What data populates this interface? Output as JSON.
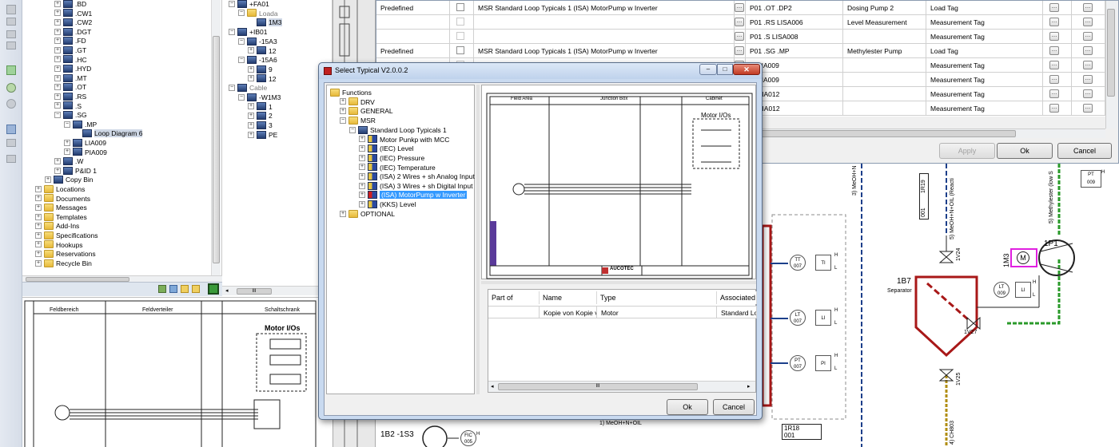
{
  "left_tree": {
    "items": [
      {
        "text": ".BD",
        "level": 3
      },
      {
        "text": ".CW1",
        "level": 3
      },
      {
        "text": ".CW2",
        "level": 3
      },
      {
        "text": ".DGT",
        "level": 3
      },
      {
        "text": ".FD",
        "level": 3
      },
      {
        "text": ".GT",
        "level": 3
      },
      {
        "text": ".HC",
        "level": 3
      },
      {
        "text": ".HYD",
        "level": 3
      },
      {
        "text": ".MT",
        "level": 3
      },
      {
        "text": ".OT",
        "level": 3
      },
      {
        "text": ".RS",
        "level": 3
      },
      {
        "text": ".S",
        "level": 3
      },
      {
        "text": ".SG",
        "level": 3
      },
      {
        "text": ".MP",
        "level": 4
      },
      {
        "text": "Loop Diagram 6",
        "level": 5
      },
      {
        "text": "LIA009",
        "level": 4
      },
      {
        "text": "PIA009",
        "level": 4
      },
      {
        "text": ".W",
        "level": 3
      },
      {
        "text": "P&ID 1",
        "level": 3
      },
      {
        "text": "Copy Bin",
        "level": 2
      },
      {
        "text": "Locations",
        "level": 1
      },
      {
        "text": "Documents",
        "level": 1
      },
      {
        "text": "Messages",
        "level": 1
      },
      {
        "text": "Templates",
        "level": 1
      },
      {
        "text": "Add-Ins",
        "level": 1
      },
      {
        "text": "Specifications",
        "level": 1
      },
      {
        "text": "Hookups",
        "level": 1
      },
      {
        "text": "Reservations",
        "level": 1
      },
      {
        "text": "Recycle Bin",
        "level": 1
      }
    ]
  },
  "mid_tree": {
    "items": [
      {
        "text": "+FA01",
        "level": 1
      },
      {
        "text": "Loada",
        "level": 2
      },
      {
        "text": "1M3",
        "level": 3
      },
      {
        "text": "+IB01",
        "level": 1
      },
      {
        "text": "-15A3",
        "level": 2
      },
      {
        "text": "12",
        "level": 3
      },
      {
        "text": "-15A6",
        "level": 2
      },
      {
        "text": "9",
        "level": 3
      },
      {
        "text": "12",
        "level": 3
      },
      {
        "text": "Cable",
        "level": 1
      },
      {
        "text": "-W1M3",
        "level": 2
      },
      {
        "text": "1",
        "level": 3
      },
      {
        "text": "2",
        "level": 3
      },
      {
        "text": "3",
        "level": 3
      },
      {
        "text": "PE",
        "level": 3
      }
    ]
  },
  "left_drawing": {
    "col1": "Feldbereich",
    "col2": "Feldverteiler",
    "col3": "Schaltschrank",
    "box_title": "Motor I/Os"
  },
  "grid": {
    "rows": [
      {
        "c1": "Predefined",
        "c2": "MSR Standard Loop Typicals 1 (ISA) MotorPump w Inverter",
        "c3": "P01 .OT .DP2",
        "c4": "Dosing Pump 2",
        "c5": "Load Tag"
      },
      {
        "c1": "",
        "c2": "",
        "c3": "P01 .RS LISA006",
        "c4": "Level Measurement",
        "c5": "Measurement Tag"
      },
      {
        "c1": "",
        "c2": "",
        "c3": "P01 .S LISA008",
        "c4": "",
        "c5": "Measurement Tag"
      },
      {
        "c1": "Predefined",
        "c2": "MSR Standard Loop Typicals 1 (ISA) MotorPump w Inverter",
        "c3": "P01 .SG .MP",
        "c4": "Methylester Pump",
        "c5": "Load Tag"
      },
      {
        "c1": "",
        "c2": "",
        "c3": "G PIA009",
        "c4": "",
        "c5": "Measurement Tag"
      },
      {
        "c1": "",
        "c2": "",
        "c3": "G PIA009",
        "c4": "",
        "c5": "Measurement Tag"
      },
      {
        "c1": "",
        "c2": "",
        "c3": "W LIA012",
        "c4": "",
        "c5": "Measurement Tag"
      },
      {
        "c1": "",
        "c2": "",
        "c3": "W TIA012",
        "c4": "",
        "c5": "Measurement Tag"
      }
    ],
    "apply_label": "Apply",
    "ok_label": "Ok",
    "cancel_label": "Cancel"
  },
  "pid": {
    "pt_label": "PT",
    "pt_num": "009",
    "motor_tag": "1M3",
    "motor_letter": "M",
    "pump_tag": "1P1",
    "separator_tag": "1B7",
    "separator_label": "Separator",
    "lt1": "LT",
    "lt1_num": "009",
    "li": "LI",
    "valve1": "1V24",
    "valve2": "1V27",
    "valve3": "1V25",
    "tt": "TT",
    "tt_num": "007",
    "ti": "TI",
    "lt2": "LT",
    "lt2_num": "007",
    "li2": "LI",
    "pt2": "PT",
    "pt2_num": "007",
    "pi2": "PI",
    "h": "H",
    "l": "L",
    "tag_1r19": "1R19",
    "num_001a": "001",
    "tag_1r18": "1R18",
    "num_001b": "001",
    "bottom_tag": "1B2 -1S3",
    "fic": "FIC",
    "fic_num": "005",
    "line_meoh": "3) MeOH+N",
    "line_meoh2": "5) MeOH+N+OIL (Reacti",
    "line_methylester": "5) Methylester (low S",
    "line_bottom": "1) MeOH+N+OIL",
    "line_ch": "4) CH803"
  },
  "dialog": {
    "title": "Select Typical V2.0.0.2",
    "tree": [
      {
        "text": "Functions",
        "level": 0,
        "exp": ""
      },
      {
        "text": "DRV",
        "level": 1,
        "exp": "+"
      },
      {
        "text": "GENERAL",
        "level": 1,
        "exp": "+"
      },
      {
        "text": "MSR",
        "level": 1,
        "exp": "-"
      },
      {
        "text": "Standard Loop Typicals 1",
        "level": 2,
        "exp": "-"
      },
      {
        "text": "Motor Punkp with MCC",
        "level": 3,
        "exp": "+"
      },
      {
        "text": "(IEC) Level",
        "level": 3,
        "exp": "+"
      },
      {
        "text": "(IEC) Pressure",
        "level": 3,
        "exp": "+"
      },
      {
        "text": "(IEC) Temperature",
        "level": 3,
        "exp": "+"
      },
      {
        "text": "(ISA) 2 Wires + sh Analog Input",
        "level": 3,
        "exp": "+"
      },
      {
        "text": "(ISA) 3 Wires + sh Digital Input",
        "level": 3,
        "exp": "+"
      },
      {
        "text": "(ISA) MotorPump w Inverter",
        "level": 3,
        "exp": "+"
      },
      {
        "text": "(KKS) Level",
        "level": 3,
        "exp": "+"
      },
      {
        "text": "OPTIONAL",
        "level": 1,
        "exp": "+"
      }
    ],
    "preview": {
      "col1": "Field Area",
      "col2": "Junction Box",
      "col3": "Cabinet",
      "box_title": "Motor I/Os",
      "brand": "AUCOTEC"
    },
    "table": {
      "headers": [
        "Part of",
        "Name",
        "Type",
        "Associated I"
      ],
      "rows": [
        [
          "",
          "Kopie von Kopie v",
          "Motor",
          "Standard Lo"
        ]
      ]
    },
    "scroll_glyph": "III",
    "ok_label": "Ok",
    "cancel_label": "Cancel",
    "min_glyph": "–",
    "max_glyph": "□",
    "close_glyph": "✕"
  },
  "left_scroll_glyph": "III"
}
